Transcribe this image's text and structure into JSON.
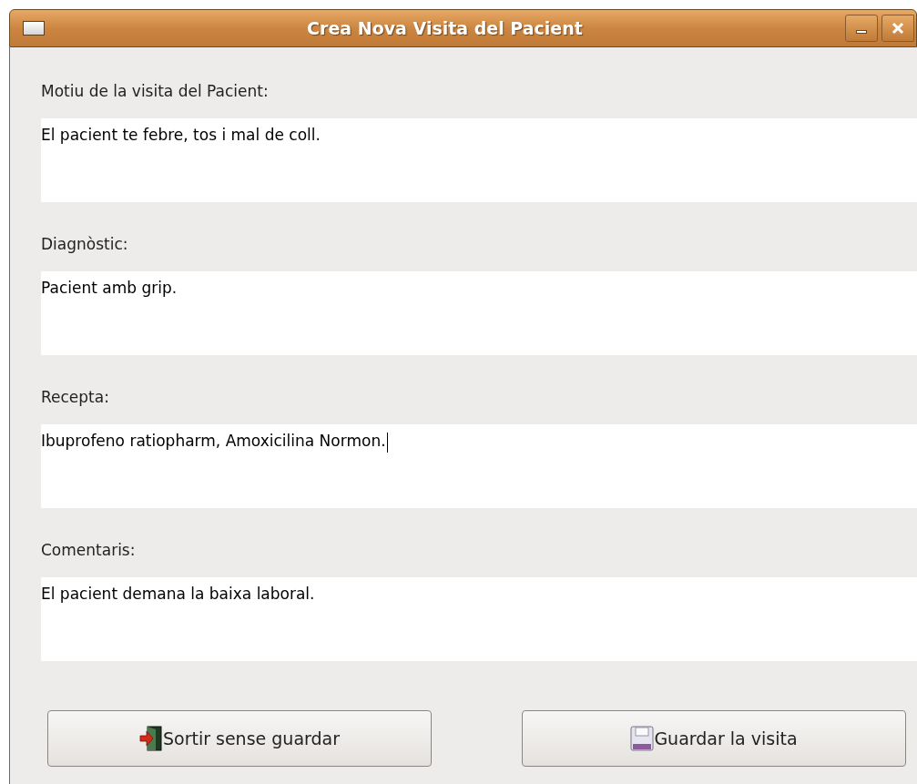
{
  "window": {
    "title": "Crea Nova Visita del Pacient"
  },
  "fields": [
    {
      "label": "Motiu de la visita del Pacient:",
      "value": "El pacient te febre, tos i mal de coll.",
      "focused": false
    },
    {
      "label": "Diagnòstic:",
      "value": "Pacient amb grip.",
      "focused": false
    },
    {
      "label": "Recepta:",
      "value": "Ibuprofeno ratiopharm, Amoxicilina Normon.",
      "focused": true
    },
    {
      "label": "Comentaris:",
      "value": "El pacient demana la baixa laboral.",
      "focused": false
    }
  ],
  "buttons": [
    {
      "label": "Sortir sense guardar",
      "kind": "exit"
    },
    {
      "label": "Guardar la visita",
      "kind": "save"
    }
  ]
}
